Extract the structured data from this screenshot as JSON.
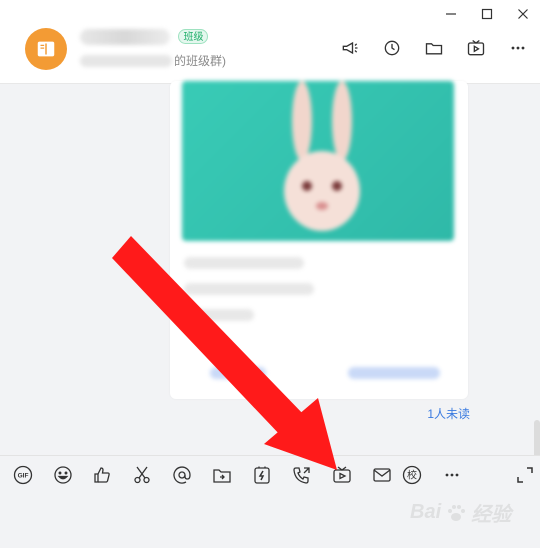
{
  "header": {
    "badge": "班级",
    "subtitle_suffix": "的班级群)"
  },
  "window_controls": [
    "minimize-icon",
    "maximize-icon",
    "close-icon"
  ],
  "header_tools": [
    "announcement-icon",
    "history-icon",
    "folder-icon",
    "live-video-icon",
    "more-icon"
  ],
  "chat": {
    "unread_label": "1人未读"
  },
  "toolbar": {
    "gif_label": "GIF",
    "school_label": "校",
    "more_label": "···",
    "icons": [
      "gif-icon",
      "emoji-icon",
      "thumbs-up-icon",
      "scissors-icon",
      "at-icon",
      "file-icon",
      "flash-icon",
      "phone-icon",
      "live-tv-icon",
      "mail-icon",
      "school-icon",
      "more-icon",
      "expand-icon"
    ]
  },
  "watermark": {
    "text": "Bai",
    "suffix": "经验"
  },
  "colors": {
    "accent": "#3b7be0",
    "avatar": "#f39b34",
    "badge": "#1fae6a",
    "annotation": "#ff1a1a"
  }
}
